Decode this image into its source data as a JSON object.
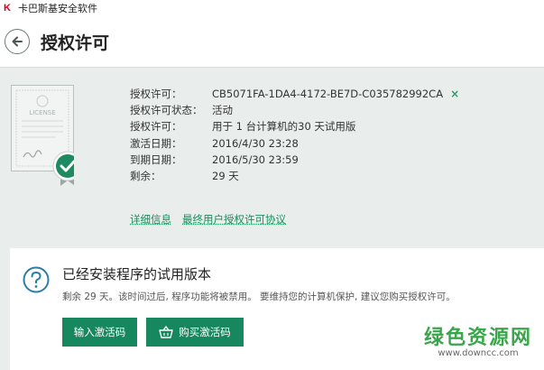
{
  "window": {
    "app_title": "卡巴斯基安全软件",
    "logo_glyph": "K"
  },
  "header": {
    "title": "授权许可"
  },
  "license": {
    "rows": [
      {
        "label": "授权许可：",
        "value": "CB5071FA-1DA4-4172-BE7D-C035782992CA"
      },
      {
        "label": "授权许可状态：",
        "value": "活动"
      },
      {
        "label": "授权许可：",
        "value": "用于 1 台计算机的30 天试用版"
      },
      {
        "label": "激活日期：",
        "value": "2016/4/30 23:28"
      },
      {
        "label": "到期日期：",
        "value": "2016/5/30 23:59"
      },
      {
        "label": "剩余：",
        "value": "29 天"
      }
    ],
    "remove_symbol": "×",
    "certificate_text": "LICENSE"
  },
  "links": {
    "details": "详细信息",
    "eula": "最终用户授权许可协议"
  },
  "trial_panel": {
    "title": "已经安装程序的试用版本",
    "description": "剩余 29 天。该时间过后, 程序功能将被禁用。 要维持您的计算机保护, 建议您购买授权许可。",
    "enter_code_label": "输入激活码",
    "buy_code_label": "购买激活码"
  },
  "watermark": {
    "text": "绿色资源网",
    "url": "www.downcc.com"
  },
  "colors": {
    "accent": "#16875e",
    "link": "#1c8c5c",
    "brand": "#d0021b"
  }
}
